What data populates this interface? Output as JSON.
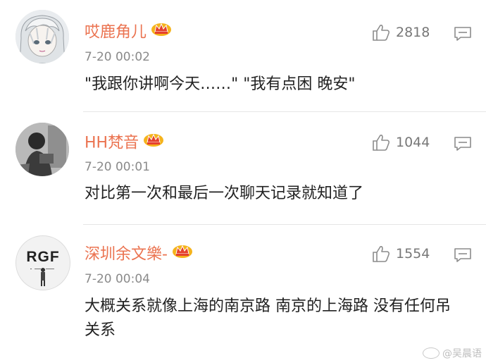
{
  "comments": [
    {
      "username": "哎鹿角儿",
      "timestamp": "7-20 00:02",
      "likes": "2818",
      "text": "\"我跟你讲啊今天……\"  \"我有点困 晚安\"",
      "avatar_style": "anime-character",
      "vip": true
    },
    {
      "username": "HH梵音",
      "timestamp": "7-20 00:01",
      "likes": "1044",
      "text": "对比第一次和最后一次聊天记录就知道了",
      "avatar_style": "photo",
      "vip": true
    },
    {
      "username": "深圳余文樂-",
      "timestamp": "7-20 00:04",
      "likes": "1554",
      "text": "大概关系就像上海的南京路 南京的上海路 没有任何吊关系",
      "avatar_style": "RGF-logo",
      "avatar_label": "RGF",
      "vip": true
    }
  ],
  "watermark": {
    "icon": "weibo-icon",
    "text": "@吴晨语"
  },
  "colors": {
    "username": "#eb7350",
    "timestamp": "#8a8a8a",
    "body_text": "#222222",
    "icon_gray": "#8c8c8c",
    "divider": "#e6e6e6",
    "crown_gold": "#f5b31c",
    "crown_red": "#e5412d"
  }
}
